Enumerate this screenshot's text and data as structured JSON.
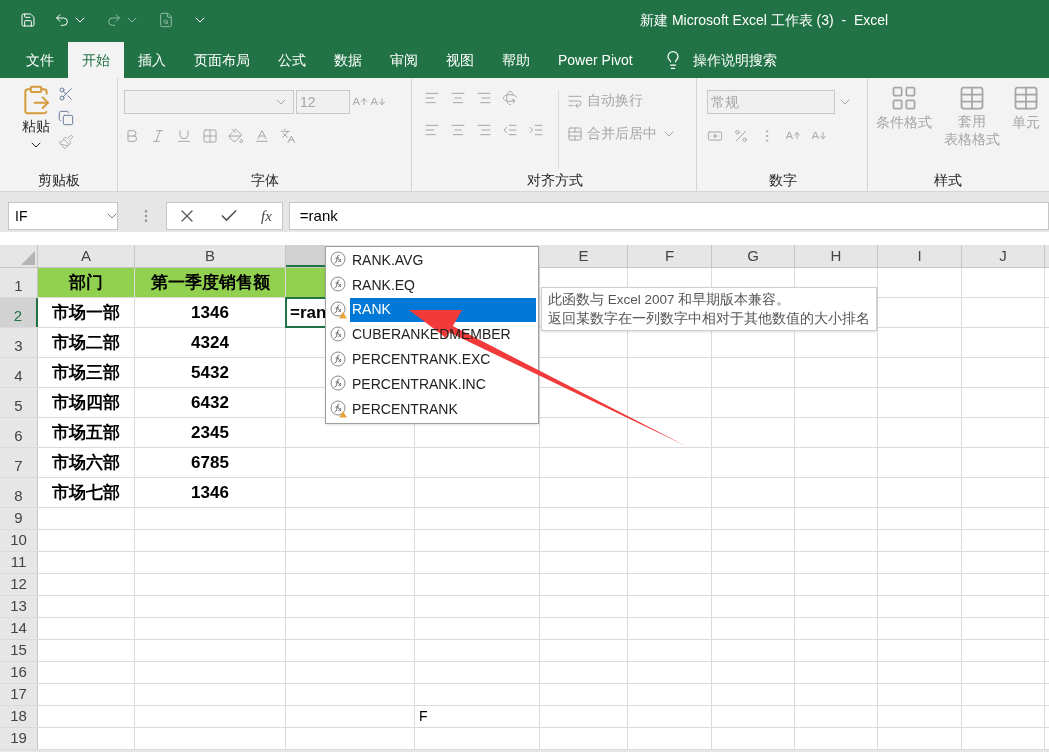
{
  "window": {
    "title": "新建 Microsoft Excel 工作表 (3)  -  Excel"
  },
  "tabs": [
    {
      "label": "文件",
      "selected": false
    },
    {
      "label": "开始",
      "selected": true
    },
    {
      "label": "插入",
      "selected": false
    },
    {
      "label": "页面布局",
      "selected": false
    },
    {
      "label": "公式",
      "selected": false
    },
    {
      "label": "数据",
      "selected": false
    },
    {
      "label": "审阅",
      "selected": false
    },
    {
      "label": "视图",
      "selected": false
    },
    {
      "label": "帮助",
      "selected": false
    },
    {
      "label": "Power Pivot",
      "selected": false
    }
  ],
  "tell_me": "操作说明搜索",
  "ribbon": {
    "clipboard": {
      "label": "剪贴板",
      "paste": "粘贴",
      "disabled": false
    },
    "font": {
      "label": "字体",
      "size": "12",
      "disabled": true
    },
    "alignment": {
      "label": "对齐方式",
      "wrap": "自动换行",
      "merge": "合并后居中",
      "disabled": true
    },
    "number": {
      "label": "数字",
      "format": "常规",
      "disabled": true
    },
    "styles": {
      "label": "样式",
      "conditional": "条件格式",
      "table_line1": "套用",
      "table_line2": "表格格式",
      "cell_styles": "单元",
      "disabled": true
    }
  },
  "formula_bar": {
    "name_box": "IF",
    "fx": "fx",
    "formula": "=rank"
  },
  "sheet": {
    "columns": [
      {
        "label": "A",
        "selected": false
      },
      {
        "label": "B",
        "selected": false
      },
      {
        "selected": true
      },
      {
        "label": "E",
        "selected": false
      },
      {
        "label": "F",
        "selected": false
      },
      {
        "label": "G",
        "selected": false
      },
      {
        "label": "H",
        "selected": false
      },
      {
        "label": "I",
        "selected": false
      },
      {
        "label": "J",
        "selected": false
      }
    ],
    "rows": [
      {
        "number": "1",
        "selected": false,
        "kind": "header",
        "cells": [
          "部门",
          "第一季度销售额"
        ]
      },
      {
        "number": "2",
        "selected": true,
        "kind": "data",
        "cells": [
          "市场一部",
          "1346"
        ]
      },
      {
        "number": "3",
        "selected": false,
        "kind": "data",
        "cells": [
          "市场二部",
          "4324"
        ]
      },
      {
        "number": "4",
        "selected": false,
        "kind": "data",
        "cells": [
          "市场三部",
          "5432"
        ]
      },
      {
        "number": "5",
        "selected": false,
        "kind": "data",
        "cells": [
          "市场四部",
          "6432"
        ]
      },
      {
        "number": "6",
        "selected": false,
        "kind": "data",
        "cells": [
          "市场五部",
          "2345"
        ]
      },
      {
        "number": "7",
        "selected": false,
        "kind": "data",
        "cells": [
          "市场六部",
          "6785"
        ]
      },
      {
        "number": "8",
        "selected": false,
        "kind": "data",
        "cells": [
          "市场七部",
          "1346"
        ]
      },
      {
        "number": "9",
        "selected": false,
        "kind": "empty"
      },
      {
        "number": "10",
        "selected": false,
        "kind": "empty"
      },
      {
        "number": "11",
        "selected": false,
        "kind": "empty"
      },
      {
        "number": "12",
        "selected": false,
        "kind": "empty"
      },
      {
        "number": "13",
        "selected": false,
        "kind": "empty"
      },
      {
        "number": "14",
        "selected": false,
        "kind": "empty"
      },
      {
        "number": "15",
        "selected": false,
        "kind": "empty"
      },
      {
        "number": "16",
        "selected": false,
        "kind": "empty"
      },
      {
        "number": "17",
        "selected": false,
        "kind": "empty"
      },
      {
        "number": "18",
        "selected": false,
        "kind": "empty",
        "note": "F"
      },
      {
        "number": "19",
        "selected": false,
        "kind": "empty"
      }
    ],
    "active_cell": {
      "value": "=ran"
    }
  },
  "autocomplete": {
    "items": [
      {
        "label": "RANK.AVG",
        "selected": false,
        "kind": "function"
      },
      {
        "label": "RANK.EQ",
        "selected": false,
        "kind": "function"
      },
      {
        "label": "RANK",
        "selected": true,
        "kind": "compat"
      },
      {
        "label": "CUBERANKEDMEMBER",
        "selected": false,
        "kind": "function"
      },
      {
        "label": "PERCENTRANK.EXC",
        "selected": false,
        "kind": "function"
      },
      {
        "label": "PERCENTRANK.INC",
        "selected": false,
        "kind": "function"
      },
      {
        "label": "PERCENTRANK",
        "selected": false,
        "kind": "compat"
      }
    ]
  },
  "tooltip": {
    "lines": [
      "此函数与 Excel 2007 和早期版本兼容。",
      "返回某数字在一列数字中相对于其他数值的大小排名"
    ]
  }
}
